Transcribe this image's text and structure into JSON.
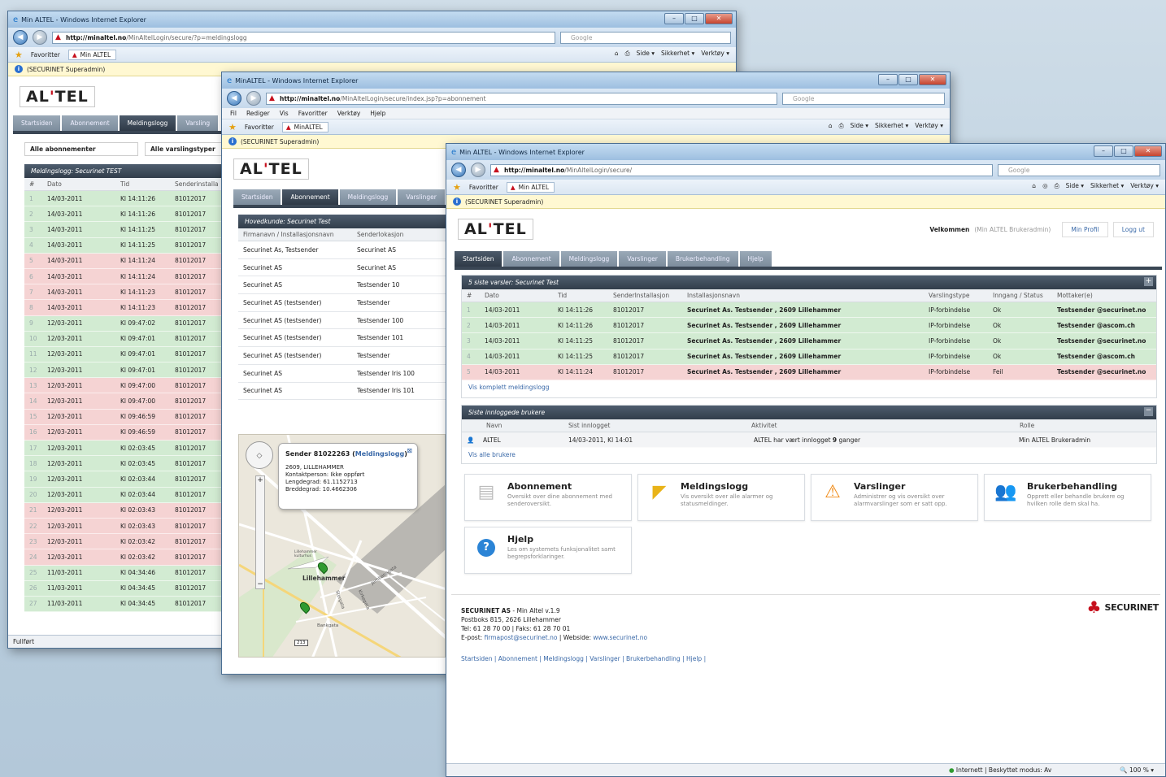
{
  "win1": {
    "title": "Min ALTEL - Windows Internet Explorer",
    "address_host": "http://minaltel.no",
    "address_path": "/MinAltelLogin/secure/?p=meldingslogg",
    "search_placeholder": "Google",
    "favorites": "Favoritter",
    "tab": "Min ALTEL",
    "cmd": [
      "Side ▾",
      "Sikkerhet ▾",
      "Verktøy ▾"
    ],
    "info": "(SECURINET Superadmin)",
    "logo": "ALTEL",
    "tabs": [
      "Startsiden",
      "Abonnement",
      "Meldingslogg",
      "Varsling"
    ],
    "filter1": "Alle abonnementer",
    "filter2": "Alle varslingstyper",
    "panel_title": "Meldingslogg: Securinet TEST",
    "cols": [
      "#",
      "Dato",
      "Tid",
      "Senderinstalla"
    ],
    "rows": [
      {
        "n": "1",
        "d": "14/03-2011",
        "t": "Kl 14:11:26",
        "s": "81012017",
        "st": "ok"
      },
      {
        "n": "2",
        "d": "14/03-2011",
        "t": "Kl 14:11:26",
        "s": "81012017",
        "st": "ok"
      },
      {
        "n": "3",
        "d": "14/03-2011",
        "t": "Kl 14:11:25",
        "s": "81012017",
        "st": "ok"
      },
      {
        "n": "4",
        "d": "14/03-2011",
        "t": "Kl 14:11:25",
        "s": "81012017",
        "st": "ok"
      },
      {
        "n": "5",
        "d": "14/03-2011",
        "t": "Kl 14:11:24",
        "s": "81012017",
        "st": "fail"
      },
      {
        "n": "6",
        "d": "14/03-2011",
        "t": "Kl 14:11:24",
        "s": "81012017",
        "st": "fail"
      },
      {
        "n": "7",
        "d": "14/03-2011",
        "t": "Kl 14:11:23",
        "s": "81012017",
        "st": "fail"
      },
      {
        "n": "8",
        "d": "14/03-2011",
        "t": "Kl 14:11:23",
        "s": "81012017",
        "st": "fail"
      },
      {
        "n": "9",
        "d": "12/03-2011",
        "t": "Kl 09:47:02",
        "s": "81012017",
        "st": "ok"
      },
      {
        "n": "10",
        "d": "12/03-2011",
        "t": "Kl 09:47:01",
        "s": "81012017",
        "st": "ok"
      },
      {
        "n": "11",
        "d": "12/03-2011",
        "t": "Kl 09:47:01",
        "s": "81012017",
        "st": "ok"
      },
      {
        "n": "12",
        "d": "12/03-2011",
        "t": "Kl 09:47:01",
        "s": "81012017",
        "st": "ok"
      },
      {
        "n": "13",
        "d": "12/03-2011",
        "t": "Kl 09:47:00",
        "s": "81012017",
        "st": "fail"
      },
      {
        "n": "14",
        "d": "12/03-2011",
        "t": "Kl 09:47:00",
        "s": "81012017",
        "st": "fail"
      },
      {
        "n": "15",
        "d": "12/03-2011",
        "t": "Kl 09:46:59",
        "s": "81012017",
        "st": "fail"
      },
      {
        "n": "16",
        "d": "12/03-2011",
        "t": "Kl 09:46:59",
        "s": "81012017",
        "st": "fail"
      },
      {
        "n": "17",
        "d": "12/03-2011",
        "t": "Kl 02:03:45",
        "s": "81012017",
        "st": "ok"
      },
      {
        "n": "18",
        "d": "12/03-2011",
        "t": "Kl 02:03:45",
        "s": "81012017",
        "st": "ok"
      },
      {
        "n": "19",
        "d": "12/03-2011",
        "t": "Kl 02:03:44",
        "s": "81012017",
        "st": "ok"
      },
      {
        "n": "20",
        "d": "12/03-2011",
        "t": "Kl 02:03:44",
        "s": "81012017",
        "st": "ok"
      },
      {
        "n": "21",
        "d": "12/03-2011",
        "t": "Kl 02:03:43",
        "s": "81012017",
        "st": "fail"
      },
      {
        "n": "22",
        "d": "12/03-2011",
        "t": "Kl 02:03:43",
        "s": "81012017",
        "st": "fail"
      },
      {
        "n": "23",
        "d": "12/03-2011",
        "t": "Kl 02:03:42",
        "s": "81012017",
        "st": "fail"
      },
      {
        "n": "24",
        "d": "12/03-2011",
        "t": "Kl 02:03:42",
        "s": "81012017",
        "st": "fail"
      },
      {
        "n": "25",
        "d": "11/03-2011",
        "t": "Kl 04:34:46",
        "s": "81012017",
        "st": "ok"
      },
      {
        "n": "26",
        "d": "11/03-2011",
        "t": "Kl 04:34:45",
        "s": "81012017",
        "st": "ok"
      },
      {
        "n": "27",
        "d": "11/03-2011",
        "t": "Kl 04:34:45",
        "s": "81012017",
        "st": "ok"
      }
    ],
    "status": "Fullført"
  },
  "win2": {
    "title": "MinALTEL - Windows Internet Explorer",
    "address_host": "http://minaltel.no",
    "address_path": "/MinAltelLogin/secure/index.jsp?p=abonnement",
    "search_placeholder": "Google",
    "menu": [
      "Fil",
      "Rediger",
      "Vis",
      "Favoritter",
      "Verktøy",
      "Hjelp"
    ],
    "favorites": "Favoritter",
    "tab": "MinALTEL",
    "cmd": [
      "Side ▾",
      "Sikkerhet ▾",
      "Verktøy ▾"
    ],
    "info": "(SECURINET Superadmin)",
    "logo": "ALTEL",
    "tabs": [
      "Startsiden",
      "Abonnement",
      "Meldingslogg",
      "Varslinger"
    ],
    "panel_title": "Hovedkunde: Securinet Test",
    "cols": [
      "Firmanavn / Installasjonsnavn",
      "Senderlokasjon"
    ],
    "rows": [
      {
        "a": "Securinet As, Testsender",
        "b": "Securinet AS"
      },
      {
        "a": "Securinet AS",
        "b": "Securinet AS"
      },
      {
        "a": "Securinet AS",
        "b": "Testsender 10"
      },
      {
        "a": "Securinet AS (testsender)",
        "b": "Testsender"
      },
      {
        "a": "Securinet AS (testsender)",
        "b": "Testsender  100"
      },
      {
        "a": "Securinet AS (testsender)",
        "b": "Testsender  101"
      },
      {
        "a": "Securinet AS (testsender)",
        "b": "Testsender"
      },
      {
        "a": "Securinet AS",
        "b": "Testsender Iris 100"
      },
      {
        "a": "Securinet AS",
        "b": "Testsender Iris 101"
      }
    ],
    "map_popup": {
      "title": "Sender 81022263",
      "link": "Meldingslogg",
      "line1": "2609, LILLEHAMMER",
      "line2": "Kontaktperson: Ikke oppført",
      "line3": "Lengdegrad: 61.1152713",
      "line4": "Breddegrad: 10.4662306"
    },
    "map_labels": [
      "Lillehammer",
      "Storgata",
      "Bankgata",
      "Kirkegata",
      "Jernbanegata",
      "213",
      "Lillehammer kulturhus"
    ]
  },
  "win3": {
    "title": "Min ALTEL - Windows Internet Explorer",
    "address_host": "http://minaltel.no",
    "address_path": "/MinAltelLogin/secure/",
    "search_placeholder": "Google",
    "favorites": "Favoritter",
    "tab": "Min ALTEL",
    "cmd": [
      "Side ▾",
      "Sikkerhet ▾",
      "Verktøy ▾"
    ],
    "info": "(SECURINET Superadmin)",
    "logo": "ALTEL",
    "welcome": "Velkommen",
    "welcome_role": "(Min ALTEL Brukeradmin)",
    "min_profil": "Min Profil",
    "logg_ut": "Logg ut",
    "tabs": [
      "Startsiden",
      "Abonnement",
      "Meldingslogg",
      "Varslinger",
      "Brukerbehandling",
      "Hjelp"
    ],
    "alerts_title": "5 siste varsler: Securinet Test",
    "alert_cols": [
      "#",
      "Dato",
      "Tid",
      "SenderInstallasjon",
      "Installasjonsnavn",
      "Varslingstype",
      "Inngang / Status",
      "Mottaker(e)"
    ],
    "alerts": [
      {
        "n": "1",
        "d": "14/03-2011",
        "t": "Kl 14:11:26",
        "s": "81012017",
        "i": "Securinet As. Testsender , 2609 Lillehammer",
        "v": "IP-forbindelse",
        "st": "Ok",
        "m": "Testsender @securinet.no",
        "c": "ok"
      },
      {
        "n": "2",
        "d": "14/03-2011",
        "t": "Kl 14:11:26",
        "s": "81012017",
        "i": "Securinet As. Testsender , 2609 Lillehammer",
        "v": "IP-forbindelse",
        "st": "Ok",
        "m": "Testsender @ascom.ch",
        "c": "ok"
      },
      {
        "n": "3",
        "d": "14/03-2011",
        "t": "Kl 14:11:25",
        "s": "81012017",
        "i": "Securinet As. Testsender , 2609 Lillehammer",
        "v": "IP-forbindelse",
        "st": "Ok",
        "m": "Testsender @securinet.no",
        "c": "ok"
      },
      {
        "n": "4",
        "d": "14/03-2011",
        "t": "Kl 14:11:25",
        "s": "81012017",
        "i": "Securinet As. Testsender , 2609 Lillehammer",
        "v": "IP-forbindelse",
        "st": "Ok",
        "m": "Testsender @ascom.ch",
        "c": "ok"
      },
      {
        "n": "5",
        "d": "14/03-2011",
        "t": "Kl 14:11:24",
        "s": "81012017",
        "i": "Securinet As. Testsender , 2609 Lillehammer",
        "v": "IP-forbindelse",
        "st": "Feil",
        "m": "Testsender @securinet.no",
        "c": "fail"
      }
    ],
    "alerts_link": "Vis komplett meldingslogg",
    "users_title": "Siste innloggede brukere",
    "user_cols": [
      "Navn",
      "Sist innlogget",
      "Aktivitet",
      "Rolle"
    ],
    "user": {
      "name": "ALTEL",
      "last": "14/03-2011, Kl 14:01",
      "activity_pre": "ALTEL har vært innlogget",
      "activity_count": "9",
      "activity_post": "ganger",
      "role": "Min ALTEL Brukeradmin"
    },
    "users_link": "Vis alle brukere",
    "cards": [
      {
        "title": "Abonnement",
        "desc": "Oversikt over dine abonnement med senderoversikt."
      },
      {
        "title": "Meldingslogg",
        "desc": "Vis oversikt over alle alarmer og statusmeldinger."
      },
      {
        "title": "Varslinger",
        "desc": "Administrer og vis oversikt over alarmvarslinger som er satt opp."
      },
      {
        "title": "Brukerbehandling",
        "desc": "Opprett eller behandle brukere og hvilken rolle dem skal ha."
      },
      {
        "title": "Hjelp",
        "desc": "Les om systemets funksjonalitet samt begrepsforklaringer."
      }
    ],
    "footer": {
      "company": "SECURINET AS",
      "product": " - Min Altel v.1.9",
      "address": "Postboks 815, 2626 Lillehammer",
      "phone": "Tel: 61 28 70 00 | Faks: 61 28 70 01",
      "email_label": "E-post: ",
      "email": "firmapost@securinet.no",
      "web_label": " | Webside: ",
      "web": "www.securinet.no",
      "links": [
        "Startsiden",
        "Abonnement",
        "Meldingslogg",
        "Varslinger",
        "Brukerbehandling",
        "Hjelp"
      ],
      "brand": "SECURINET"
    },
    "status_zone": "Internett | Beskyttet modus: Av",
    "zoom": "100 %"
  }
}
